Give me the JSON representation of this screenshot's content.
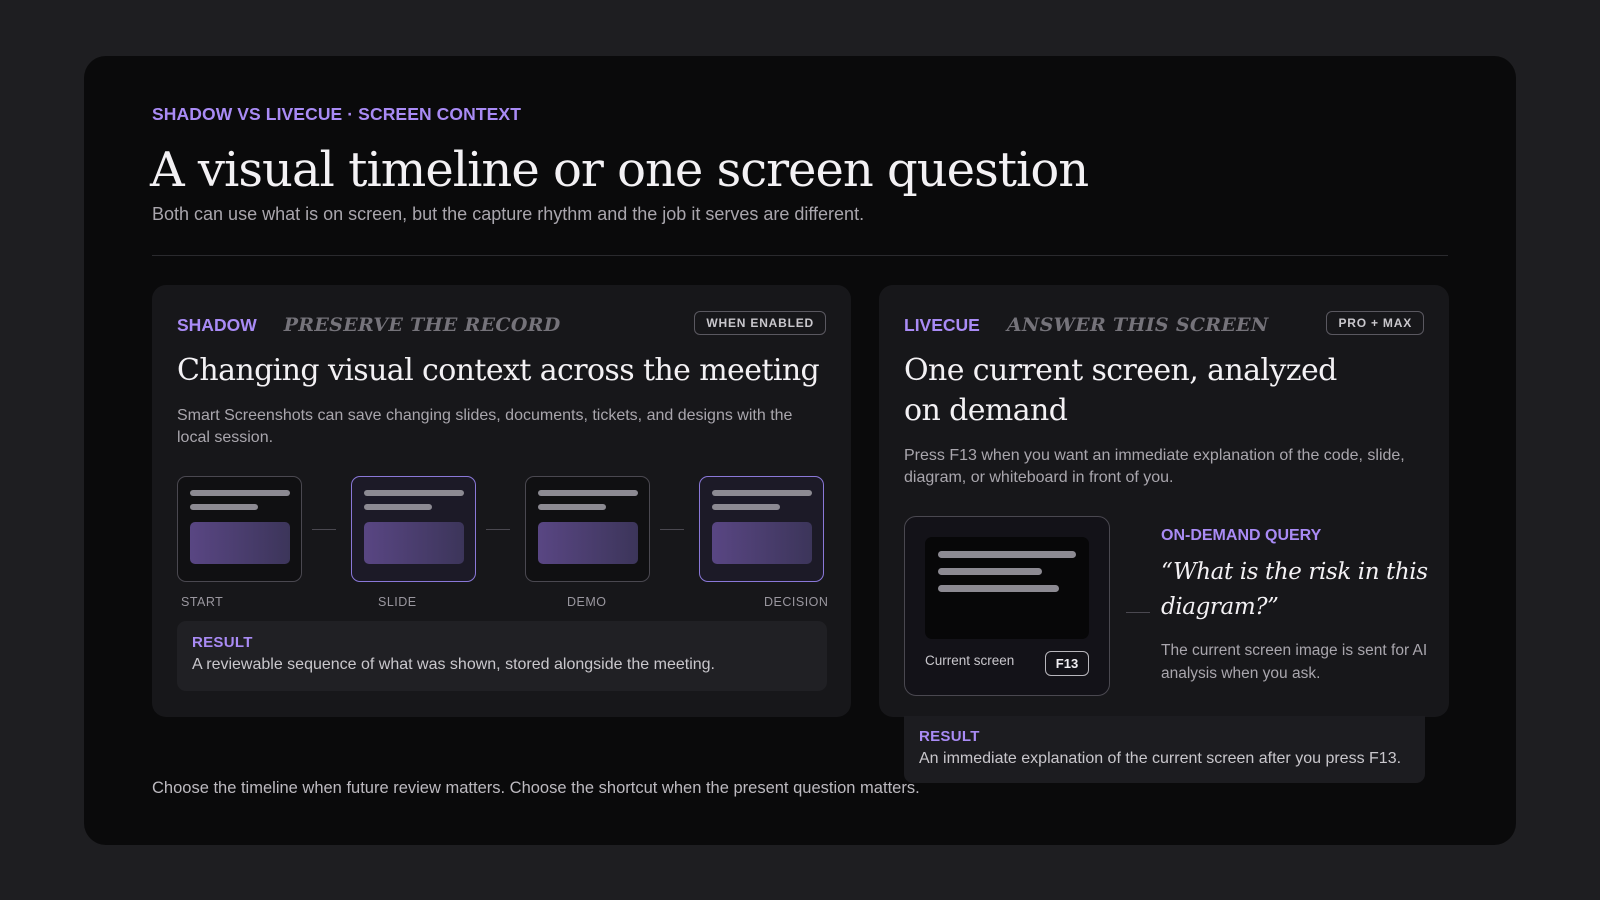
{
  "header": {
    "kicker": "SHADOW VS LIVECUE · SCREEN CONTEXT",
    "title": "A visual timeline or one screen question",
    "subtitle": "Both can use what is on screen, but the capture rhythm and the job it serves are different."
  },
  "shadow": {
    "brand": "SHADOW",
    "motto": "PRESERVE THE RECORD",
    "badge": "WHEN ENABLED",
    "title": "Changing visual context across the meeting",
    "description": "Smart Screenshots can save changing slides, documents, tickets, and designs with the local session.",
    "timeline": [
      {
        "label": "START"
      },
      {
        "label": "SLIDE"
      },
      {
        "label": "DEMO"
      },
      {
        "label": "DECISION"
      }
    ],
    "result_title": "RESULT",
    "result_text": "A reviewable sequence of what was shown, stored alongside the meeting."
  },
  "livecue": {
    "brand": "LIVECUE",
    "motto": "ANSWER THIS SCREEN",
    "badge": "PRO + MAX",
    "title": "One current screen, analyzed on demand",
    "description": "Press F13 when you want an immediate explanation of the code, slide, diagram, or whiteboard in front of you.",
    "screen_caption": "Current screen",
    "key": "F13",
    "query_label": "ON-DEMAND QUERY",
    "query": "“What is the risk in this diagram?”",
    "query_note": "The current screen image is sent for AI analysis when you ask.",
    "result_title": "RESULT",
    "result_text": "An immediate explanation of the current screen after you press F13."
  },
  "footer": "Choose the timeline when future review matters. Choose the shortcut when the present question matters."
}
